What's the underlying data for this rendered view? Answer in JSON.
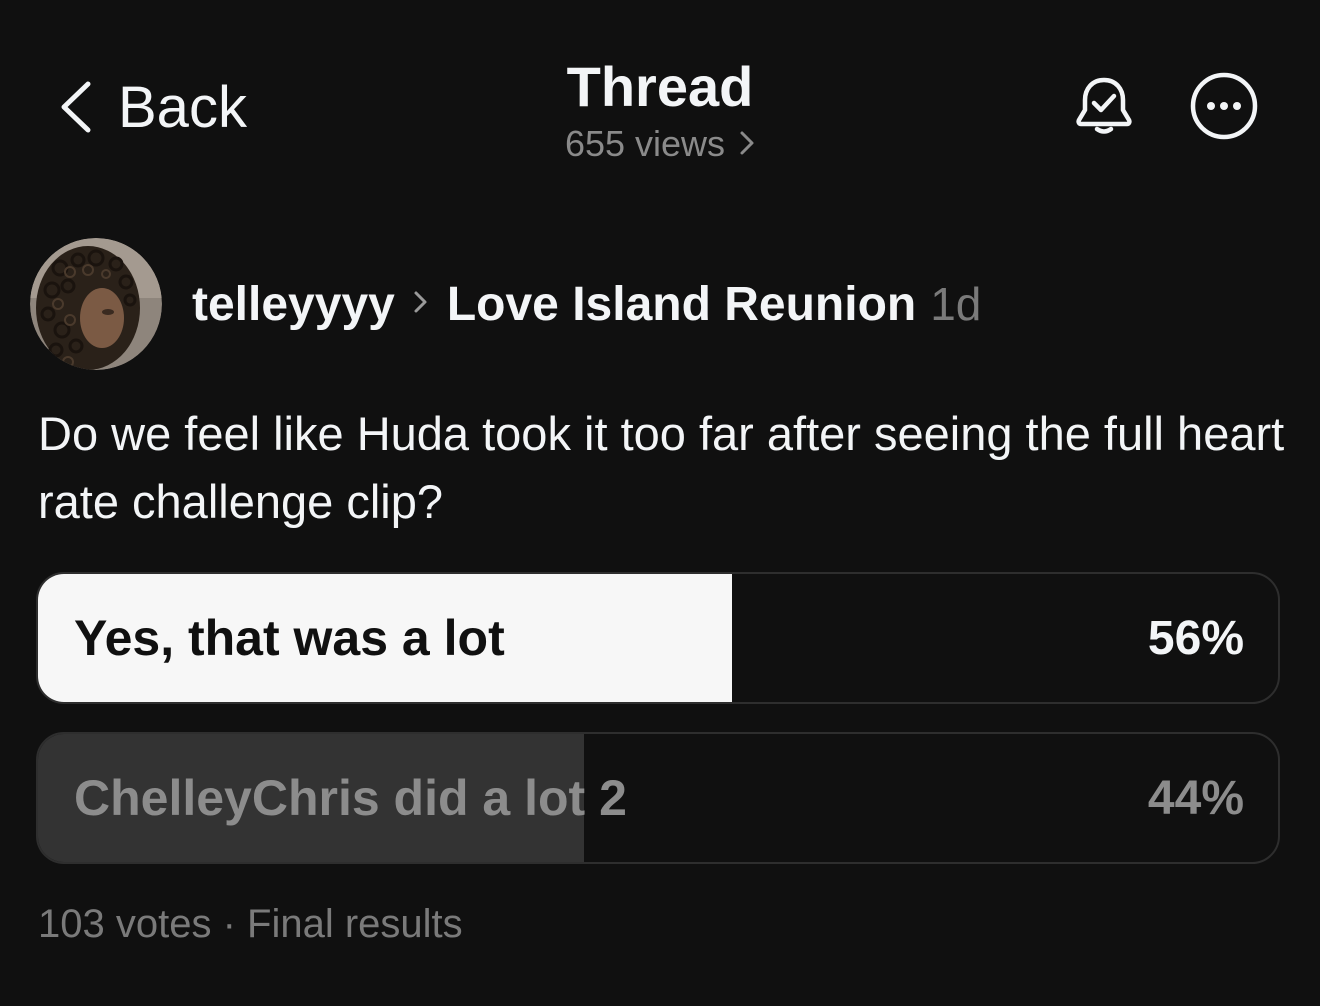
{
  "header": {
    "back_label": "Back",
    "title": "Thread",
    "views": "655 views",
    "icons": {
      "back": "chevron-left-icon",
      "views_more": "chevron-right-icon",
      "notify": "bell-check-icon",
      "more": "more-horizontal-icon"
    }
  },
  "post": {
    "author": "telleyyyy",
    "separator_icon": "chevron-right-icon",
    "community": "Love Island Reunion",
    "time": "1d",
    "text": "Do we feel like Huda took it too far after seeing the full heart rate challenge clip?"
  },
  "poll": {
    "options": [
      {
        "label": "Yes, that was a lot",
        "percent_label": "56%",
        "percent": 56,
        "leading": true
      },
      {
        "label": "ChelleyChris did a lot 2",
        "percent_label": "44%",
        "percent": 44,
        "leading": false
      }
    ],
    "votes": "103 votes",
    "dot": "·",
    "status": "Final results"
  },
  "colors": {
    "background": "#101010",
    "text_primary": "#f3f5f7",
    "text_secondary": "#7a7a7a",
    "leading_fill": "#f7f7f7",
    "other_fill": "#333333"
  }
}
